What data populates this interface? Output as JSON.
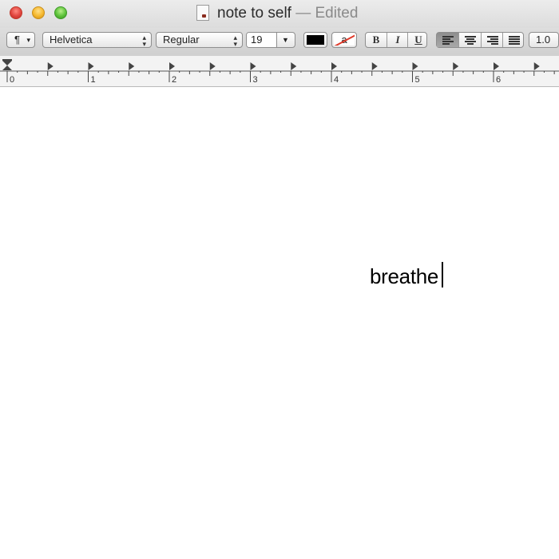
{
  "window": {
    "title": "note to self",
    "status": "— Edited"
  },
  "toolbar": {
    "paragraph_label": "¶",
    "font_family": "Helvetica",
    "font_style": "Regular",
    "font_size": "19",
    "text_color": "#000000",
    "highlight_glyph": "a",
    "bold_label": "B",
    "italic_label": "I",
    "underline_label": "U",
    "active_alignment": "left",
    "line_spacing": "1.0"
  },
  "ruler": {
    "labels": [
      "0",
      "1",
      "2",
      "3",
      "4",
      "5",
      "6"
    ]
  },
  "document": {
    "text": "breathe"
  }
}
